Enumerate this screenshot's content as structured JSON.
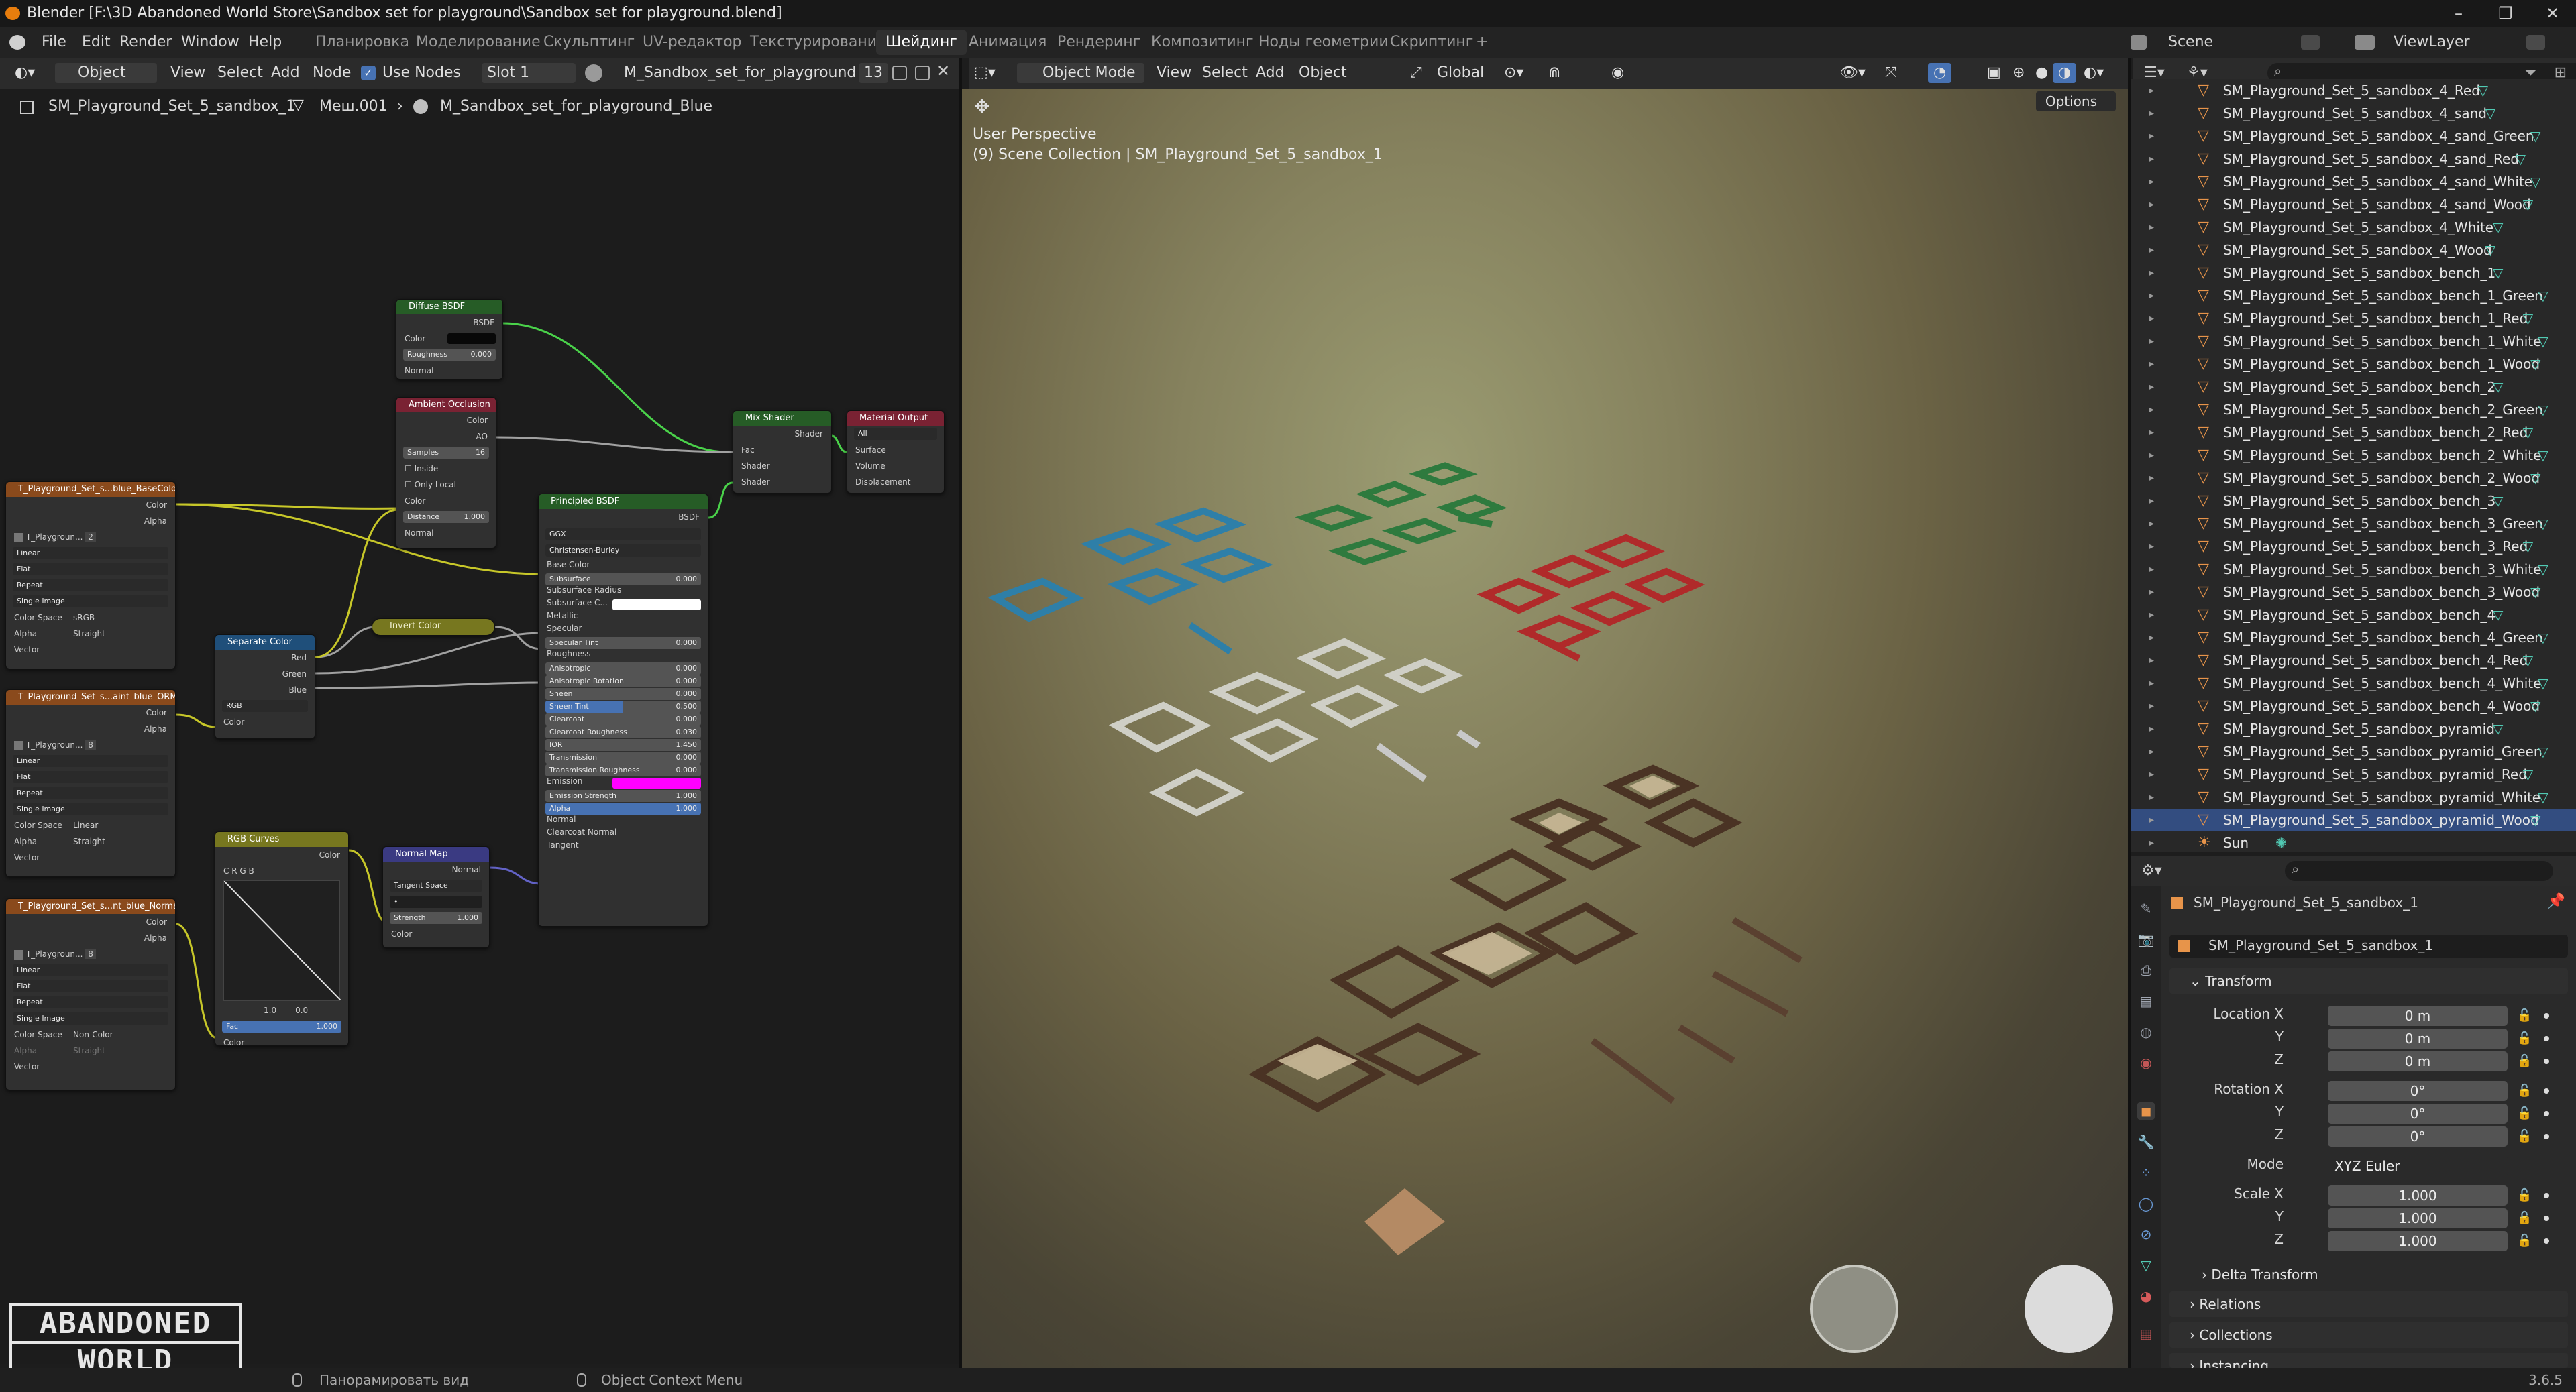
{
  "title_bar": {
    "title": "Blender [F:\\3D Abandoned World Store\\Sandbox set for playground\\Sandbox set for playground.blend]",
    "minimize": "–",
    "maximize": "❐",
    "close": "✕"
  },
  "menu": {
    "items": [
      "File",
      "Edit",
      "Render",
      "Window",
      "Help"
    ],
    "workspaces": [
      "Планировка",
      "Моделирование",
      "Скульптинг",
      "UV-редактор",
      "Текстурирование",
      "Шейдинг",
      "Анимация",
      "Рендеринг",
      "Композитинг",
      "Ноды геометрии",
      "Скриптинг"
    ],
    "active_workspace": "Шейдинг",
    "add_workspace": "+",
    "scene_label": "Scene",
    "view_layer_label": "ViewLayer"
  },
  "node_editor": {
    "header": {
      "mode": "Object",
      "menus": [
        "View",
        "Select",
        "Add",
        "Node"
      ],
      "use_nodes_label": "Use Nodes",
      "use_nodes_checked": true,
      "slot": "Slot 1",
      "material": "M_Sandbox_set_for_playground_Blue",
      "users": "13"
    },
    "breadcrumb": {
      "object": "SM_Playground_Set_5_sandbox_1",
      "mesh": "Меш.001",
      "material": "M_Sandbox_set_for_playground_Blue"
    },
    "nodes": {
      "diffuse": {
        "title": "Diffuse BSDF",
        "out": "BSDF",
        "color": "Color",
        "roughness": "Roughness",
        "roughness_val": "0.000",
        "normal": "Normal"
      },
      "ao": {
        "title": "Ambient Occlusion",
        "color_out": "Color",
        "ao_out": "AO",
        "samples": "Samples",
        "samples_val": "16",
        "inside": "Inside",
        "only_local": "Only Local",
        "color_in": "Color",
        "distance": "Distance",
        "distance_val": "1.000",
        "normal": "Normal"
      },
      "mix": {
        "title": "Mix Shader",
        "out": "Shader",
        "fac": "Fac",
        "shader1": "Shader",
        "shader2": "Shader"
      },
      "output": {
        "title": "Material Output",
        "target": "All",
        "surface": "Surface",
        "volume": "Volume",
        "displacement": "Displacement"
      },
      "principled": {
        "title": "Principled BSDF",
        "out": "BSDF",
        "dist": "GGX",
        "sss": "Christensen-Burley",
        "inputs": [
          "Base Color",
          "Subsurface",
          "Subsurface Radius",
          "Subsurface C...",
          "Metallic",
          "Specular",
          "Specular Tint",
          "Roughness",
          "Anisotropic",
          "Anisotropic Rotation",
          "Sheen",
          "Sheen Tint",
          "Clearcoat",
          "Clearcoat Roughness",
          "IOR",
          "Transmission",
          "Transmission Roughness",
          "Emission",
          "Emission Strength",
          "Alpha",
          "Normal",
          "Clearcoat Normal",
          "Tangent"
        ],
        "values": {
          "Subsurface": "0.000",
          "Specular Tint": "0.000",
          "Anisotropic": "0.000",
          "Anisotropic Rotation": "0.000",
          "Sheen": "0.000",
          "Sheen Tint": "0.500",
          "Clearcoat": "0.000",
          "Clearcoat Roughness": "0.030",
          "IOR": "1.450",
          "Transmission": "0.000",
          "Transmission Roughness": "0.000",
          "Emission Strength": "1.000",
          "Alpha": "1.000"
        }
      },
      "tex1": {
        "title": "T_Playground_Set_s...blue_BaseColor.png",
        "color": "Color",
        "alpha": "Alpha",
        "img": "T_Playgroun...",
        "users": "2",
        "interp": "Linear",
        "proj": "Flat",
        "ext": "Repeat",
        "src": "Single Image",
        "cs_label": "Color Space",
        "cs": "sRGB",
        "alpha_label": "Alpha",
        "alpha_mode": "Straight",
        "vector": "Vector"
      },
      "tex2": {
        "title": "T_Playground_Set_s...aint_blue_ORM.png",
        "color": "Color",
        "alpha": "Alpha",
        "img": "T_Playgroun...",
        "users": "8",
        "interp": "Linear",
        "proj": "Flat",
        "ext": "Repeat",
        "src": "Single Image",
        "cs_label": "Color Space",
        "cs": "Linear",
        "alpha_label": "Alpha",
        "alpha_mode": "Straight",
        "vector": "Vector"
      },
      "tex3": {
        "title": "T_Playground_Set_s...nt_blue_Normal.png",
        "color": "Color",
        "alpha": "Alpha",
        "img": "T_Playgroun...",
        "users": "8",
        "interp": "Linear",
        "proj": "Flat",
        "ext": "Repeat",
        "src": "Single Image",
        "cs_label": "Color Space",
        "cs": "Non-Color",
        "alpha_label": "Alpha",
        "alpha_mode": "Straight",
        "vector": "Vector"
      },
      "separate": {
        "title": "Separate Color",
        "red": "Red",
        "green": "Green",
        "blue": "Blue",
        "mode": "RGB",
        "color": "Color"
      },
      "invert": {
        "title": "Invert Color"
      },
      "curves": {
        "title": "RGB Curves",
        "color_out": "Color",
        "tabs": "C  R  G  B",
        "val1": "1.0",
        "val2": "0.0",
        "fac": "Fac",
        "fac_val": "1.000",
        "color_in": "Color"
      },
      "normal_map": {
        "title": "Normal Map",
        "normal": "Normal",
        "space": "Tangent Space",
        "strength": "Strength",
        "strength_val": "1.000",
        "color": "Color"
      }
    },
    "logo_line1": "ABANDONED",
    "logo_line2": "WORLD"
  },
  "viewport": {
    "header": {
      "mode": "Object Mode",
      "menus": [
        "View",
        "Select",
        "Add",
        "Object"
      ],
      "orientation": "Global",
      "options": "Options"
    },
    "overlay_perspective": "User Perspective",
    "overlay_collection": "(9) Scene Collection | SM_Playground_Set_5_sandbox_1"
  },
  "outliner": {
    "items": [
      "SM_Playground_Set_5_sandbox_4_Red",
      "SM_Playground_Set_5_sandbox_4_sand",
      "SM_Playground_Set_5_sandbox_4_sand_Green",
      "SM_Playground_Set_5_sandbox_4_sand_Red",
      "SM_Playground_Set_5_sandbox_4_sand_White",
      "SM_Playground_Set_5_sandbox_4_sand_Wood",
      "SM_Playground_Set_5_sandbox_4_White",
      "SM_Playground_Set_5_sandbox_4_Wood",
      "SM_Playground_Set_5_sandbox_bench_1",
      "SM_Playground_Set_5_sandbox_bench_1_Green",
      "SM_Playground_Set_5_sandbox_bench_1_Red",
      "SM_Playground_Set_5_sandbox_bench_1_White",
      "SM_Playground_Set_5_sandbox_bench_1_Wood",
      "SM_Playground_Set_5_sandbox_bench_2",
      "SM_Playground_Set_5_sandbox_bench_2_Green",
      "SM_Playground_Set_5_sandbox_bench_2_Red",
      "SM_Playground_Set_5_sandbox_bench_2_White",
      "SM_Playground_Set_5_sandbox_bench_2_Wood",
      "SM_Playground_Set_5_sandbox_bench_3",
      "SM_Playground_Set_5_sandbox_bench_3_Green",
      "SM_Playground_Set_5_sandbox_bench_3_Red",
      "SM_Playground_Set_5_sandbox_bench_3_White",
      "SM_Playground_Set_5_sandbox_bench_3_Wood",
      "SM_Playground_Set_5_sandbox_bench_4",
      "SM_Playground_Set_5_sandbox_bench_4_Green",
      "SM_Playground_Set_5_sandbox_bench_4_Red",
      "SM_Playground_Set_5_sandbox_bench_4_White",
      "SM_Playground_Set_5_sandbox_bench_4_Wood",
      "SM_Playground_Set_5_sandbox_pyramid",
      "SM_Playground_Set_5_sandbox_pyramid_Green",
      "SM_Playground_Set_5_sandbox_pyramid_Red",
      "SM_Playground_Set_5_sandbox_pyramid_White",
      "SM_Playground_Set_5_sandbox_pyramid_Wood",
      "Sun"
    ],
    "selected": "SM_Playground_Set_5_sandbox_pyramid_Wood"
  },
  "properties": {
    "object_name": "SM_Playground_Set_5_sandbox_1",
    "object_name2": "SM_Playground_Set_5_sandbox_1",
    "transform_label": "Transform",
    "location_label": "Location X",
    "rotation_label": "Rotation X",
    "scale_label": "Scale X",
    "y_label": "Y",
    "z_label": "Z",
    "location": [
      "0 m",
      "0 m",
      "0 m"
    ],
    "rotation": [
      "0°",
      "0°",
      "0°"
    ],
    "mode_label": "Mode",
    "mode": "XYZ Euler",
    "scale": [
      "1.000",
      "1.000",
      "1.000"
    ],
    "delta": "Delta Transform",
    "relations": "Relations",
    "collections": "Collections",
    "instancing": "Instancing"
  },
  "status": {
    "pan": "Панорамировать вид",
    "context": "Object Context Menu",
    "version": "3.6.5"
  }
}
